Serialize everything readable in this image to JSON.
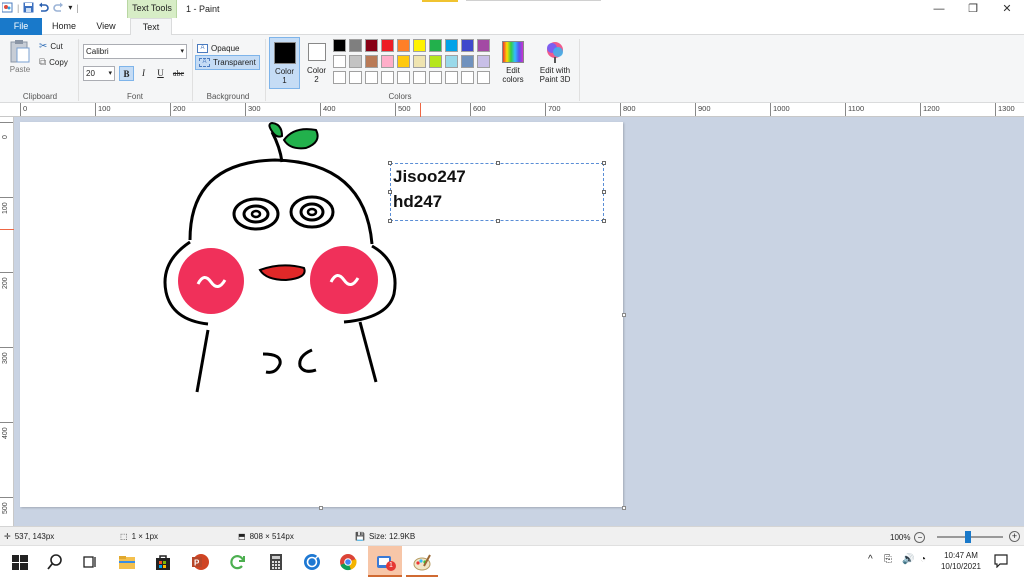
{
  "window": {
    "title": "1 - Paint",
    "context_tab": "Text Tools",
    "controls": {
      "minimize": "—",
      "maximize": "❐",
      "close": "✕"
    }
  },
  "tabs": {
    "file": "File",
    "home": "Home",
    "view": "View",
    "text": "Text"
  },
  "ribbon": {
    "clipboard": {
      "label": "Clipboard",
      "paste": "Paste",
      "cut": "Cut",
      "copy": "Copy"
    },
    "font": {
      "label": "Font",
      "family": "Calibri",
      "size": "20",
      "bold": "B",
      "italic": "I",
      "underline": "U",
      "strike": "abc"
    },
    "background": {
      "label": "Background",
      "opaque": "Opaque",
      "transparent": "Transparent"
    },
    "color1": {
      "label1": "Color",
      "label2": "1",
      "value": "#000000"
    },
    "color2": {
      "label1": "Color",
      "label2": "2",
      "value": "#ffffff"
    },
    "colors": {
      "label": "Colors",
      "row1": [
        "#000000",
        "#7f7f7f",
        "#880015",
        "#ed1c24",
        "#ff7f27",
        "#fff200",
        "#22b14c",
        "#00a2e8",
        "#3f48cc",
        "#a349a4"
      ],
      "row2": [
        "#ffffff",
        "#c3c3c3",
        "#b97a57",
        "#ffaec9",
        "#ffc90e",
        "#efe4b0",
        "#b5e61d",
        "#99d9ea",
        "#7092be",
        "#c8bfe7"
      ],
      "row3": [
        "#ffffff",
        "#ffffff",
        "#ffffff",
        "#ffffff",
        "#ffffff",
        "#ffffff",
        "#ffffff",
        "#ffffff",
        "#ffffff",
        "#ffffff"
      ]
    },
    "edit_colors": {
      "line1": "Edit",
      "line2": "colors"
    },
    "paint3d": {
      "line1": "Edit with",
      "line2": "Paint 3D"
    }
  },
  "ruler": {
    "h": [
      "0",
      "100",
      "200",
      "300",
      "400",
      "500",
      "600",
      "700",
      "800",
      "900",
      "1000",
      "1100",
      "1200",
      "1300"
    ],
    "v": [
      "0",
      "100",
      "200",
      "300",
      "400",
      "500"
    ]
  },
  "canvas_text": {
    "line1": "Jisoo247",
    "line2": "hd247"
  },
  "status": {
    "cursor": "537, 143px",
    "selection": "1 × 1px",
    "canvas_size": "808 × 514px",
    "file_size": "Size: 12.9KB",
    "zoom": "100%"
  },
  "taskbar": {
    "time": "10:47 AM",
    "date": "10/10/2021",
    "notif_badge": "1"
  }
}
